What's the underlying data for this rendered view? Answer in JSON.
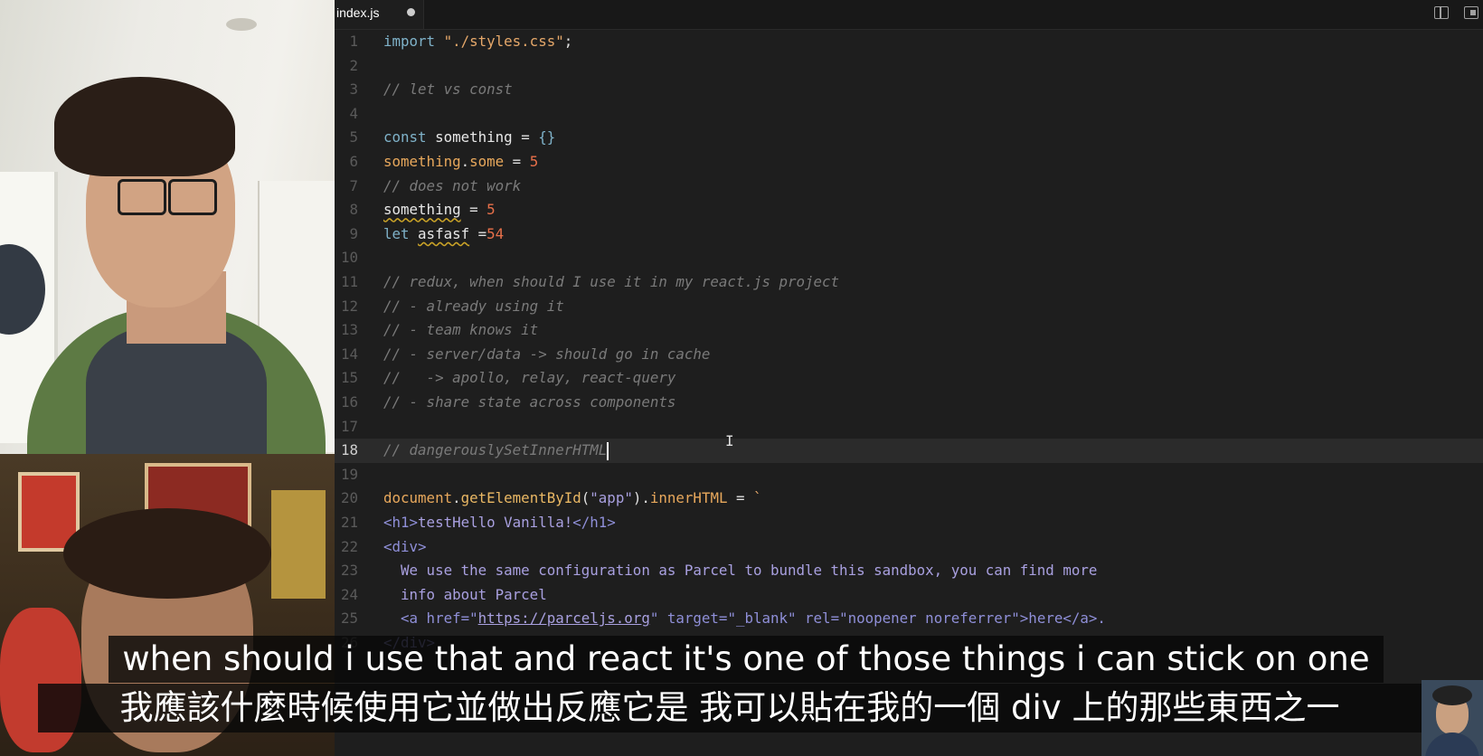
{
  "tab": {
    "label": "index.js"
  },
  "editor_lines": [
    {
      "n": "1",
      "segs": [
        [
          "import ",
          "kw"
        ],
        [
          "\"./styles.css\"",
          "str"
        ],
        [
          ";",
          "op"
        ]
      ]
    },
    {
      "n": "2",
      "segs": []
    },
    {
      "n": "3",
      "segs": [
        [
          "// let vs const",
          "cm"
        ]
      ]
    },
    {
      "n": "4",
      "segs": []
    },
    {
      "n": "5",
      "segs": [
        [
          "const ",
          "kw"
        ],
        [
          "something",
          "var"
        ],
        [
          " = ",
          "op"
        ],
        [
          "{}",
          "kw"
        ]
      ]
    },
    {
      "n": "6",
      "segs": [
        [
          "something",
          "prop"
        ],
        [
          ".",
          "op"
        ],
        [
          "some",
          "prop"
        ],
        [
          " = ",
          "op"
        ],
        [
          "5",
          "num"
        ]
      ]
    },
    {
      "n": "7",
      "segs": [
        [
          "// does not work",
          "cm"
        ]
      ]
    },
    {
      "n": "8",
      "segs": [
        [
          "something",
          "var squig"
        ],
        [
          " = ",
          "op"
        ],
        [
          "5",
          "num"
        ]
      ]
    },
    {
      "n": "9",
      "segs": [
        [
          "let ",
          "kw"
        ],
        [
          "asfasf",
          "var squig"
        ],
        [
          " =",
          "op"
        ],
        [
          "54",
          "num"
        ]
      ]
    },
    {
      "n": "10",
      "segs": []
    },
    {
      "n": "11",
      "segs": [
        [
          "// redux, when should I use it in my react.js project",
          "cm"
        ]
      ]
    },
    {
      "n": "12",
      "segs": [
        [
          "// - already using it",
          "cm"
        ]
      ]
    },
    {
      "n": "13",
      "segs": [
        [
          "// - team knows it",
          "cm"
        ]
      ]
    },
    {
      "n": "14",
      "segs": [
        [
          "// - server/data -> should go in cache",
          "cm"
        ]
      ]
    },
    {
      "n": "15",
      "segs": [
        [
          "//   -> apollo, relay, react-query",
          "cm"
        ]
      ]
    },
    {
      "n": "16",
      "segs": [
        [
          "// - share state across components",
          "cm"
        ]
      ]
    },
    {
      "n": "17",
      "segs": []
    },
    {
      "n": "18",
      "segs": [
        [
          "// dangerouslySetInnerHTML",
          "cm"
        ]
      ],
      "current": true
    },
    {
      "n": "19",
      "segs": []
    },
    {
      "n": "20",
      "segs": [
        [
          "document",
          "prop"
        ],
        [
          ".",
          "op"
        ],
        [
          "getElementById",
          "fn"
        ],
        [
          "(",
          "op"
        ],
        [
          "\"app\"",
          "txt"
        ],
        [
          ").",
          "op"
        ],
        [
          "innerHTML",
          "prop"
        ],
        [
          " = ",
          "op"
        ],
        [
          "`",
          "str"
        ]
      ]
    },
    {
      "n": "21",
      "segs": [
        [
          "<h1>",
          "tag"
        ],
        [
          "testHello Vanilla!",
          "txt"
        ],
        [
          "</h1>",
          "tag"
        ]
      ]
    },
    {
      "n": "22",
      "segs": [
        [
          "<div>",
          "tag"
        ]
      ]
    },
    {
      "n": "23",
      "segs": [
        [
          "  We use the same configuration as Parcel to bundle this sandbox, you can find more",
          "txt"
        ]
      ]
    },
    {
      "n": "24",
      "segs": [
        [
          "  info about Parcel",
          "txt"
        ]
      ]
    },
    {
      "n": "25",
      "segs": [
        [
          "  <a href=\"",
          "tag"
        ],
        [
          "https://parceljs.org",
          "txt undl"
        ],
        [
          "\" target=\"_blank\" rel=\"noopener noreferrer\">here</a>.",
          "tag"
        ]
      ]
    },
    {
      "n": "26",
      "segs": [
        [
          "</div>",
          "tag"
        ]
      ]
    }
  ],
  "subtitles": {
    "english": "when should i use that and react it's one of those things i can stick on one",
    "chinese": "我應該什麼時候使用它並做出反應它是 我可以貼在我的一個 div 上的那些東西之一"
  },
  "toolbar_icons": [
    "split-editor-icon",
    "open-preview-icon"
  ],
  "colors": {
    "editor_bg": "#1e1e1e",
    "keyword": "#7fb2c9",
    "string": "#e6a86a",
    "number": "#e8704a",
    "comment": "#7a7a7a",
    "tag": "#8f8fd8"
  }
}
